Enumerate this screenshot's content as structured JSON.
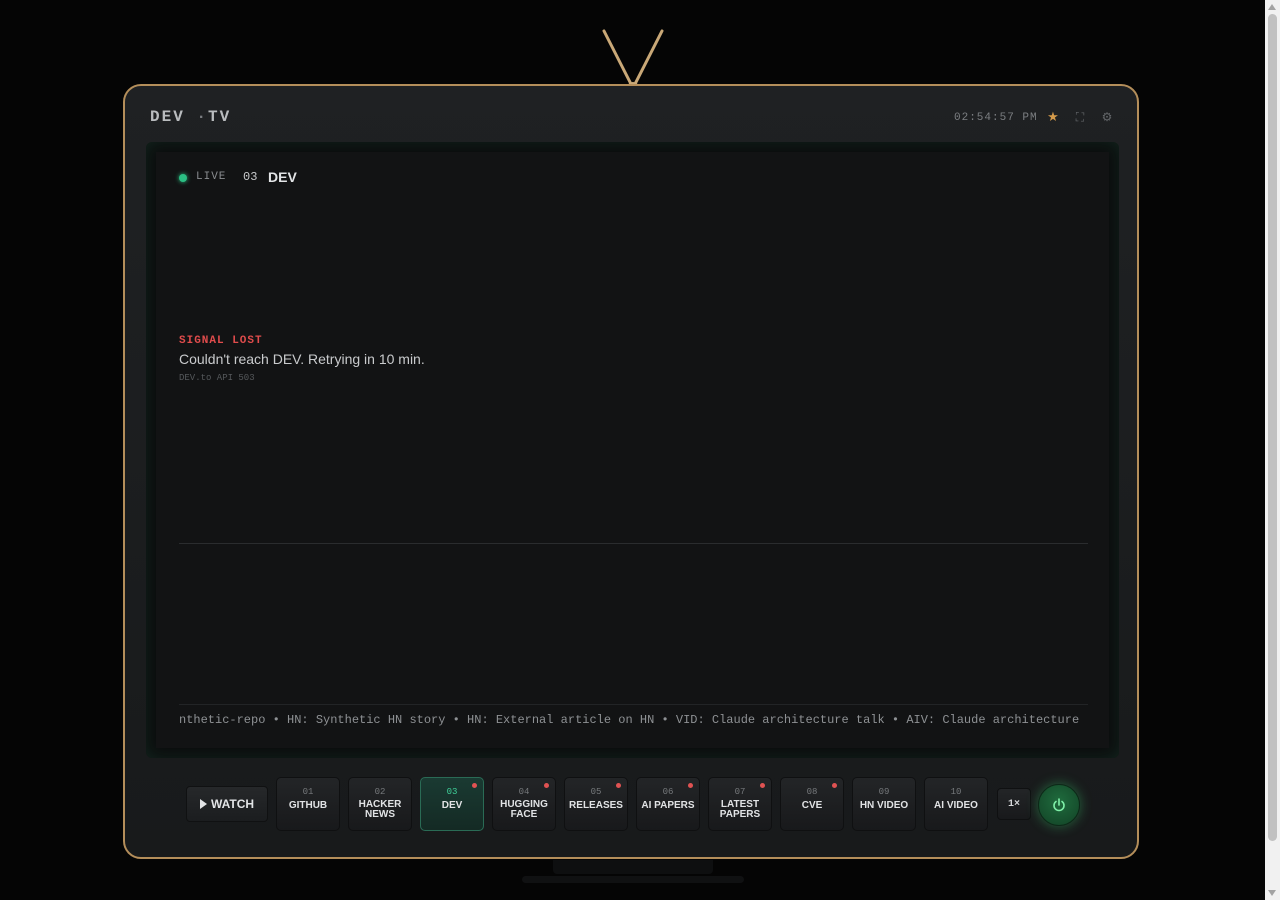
{
  "header": {
    "logo_left": "DEV",
    "logo_sep": "·",
    "logo_right": "TV",
    "clock": "02:54:57 PM",
    "icons": [
      "star-icon",
      "fullscreen-icon",
      "gear-icon"
    ],
    "star_glyph": "★",
    "fullscreen_glyph": "⛶",
    "gear_glyph": "⚙"
  },
  "screen": {
    "status": "LIVE",
    "channel_number": "03",
    "channel_name": "DEV",
    "signal": {
      "title": "SIGNAL LOST",
      "message": "Couldn't reach DEV. Retrying in 10 min.",
      "error": "DEV.to API 503"
    },
    "ticker": "nthetic-repo • HN: Synthetic HN story • HN: External article on HN • VID: Claude architecture talk • AIV: Claude architecture"
  },
  "controls": {
    "watch_label": "WATCH",
    "speed_label": "1×",
    "channels": [
      {
        "num": "01",
        "line1": "GITHUB",
        "line2": "",
        "dot": false,
        "active": false
      },
      {
        "num": "02",
        "line1": "HACKER",
        "line2": "NEWS",
        "dot": false,
        "active": false
      },
      {
        "num": "03",
        "line1": "DEV",
        "line2": "",
        "dot": true,
        "active": true
      },
      {
        "num": "04",
        "line1": "HUGGING",
        "line2": "FACE",
        "dot": true,
        "active": false
      },
      {
        "num": "05",
        "line1": "RELEASES",
        "line2": "",
        "dot": true,
        "active": false
      },
      {
        "num": "06",
        "line1": "AI PAPERS",
        "line2": "",
        "dot": true,
        "active": false
      },
      {
        "num": "07",
        "line1": "LATEST",
        "line2": "PAPERS",
        "dot": true,
        "active": false
      },
      {
        "num": "08",
        "line1": "CVE",
        "line2": "",
        "dot": true,
        "active": false
      },
      {
        "num": "09",
        "line1": "HN VIDEO",
        "line2": "",
        "dot": false,
        "active": false
      },
      {
        "num": "10",
        "line1": "AI VIDEO",
        "line2": "",
        "dot": false,
        "active": false
      }
    ]
  },
  "colors": {
    "frame": "#b48e5a",
    "live": "#2bbf83",
    "alert": "#e04c4c",
    "star": "#d49a4a",
    "power": "#1f6b3d"
  }
}
